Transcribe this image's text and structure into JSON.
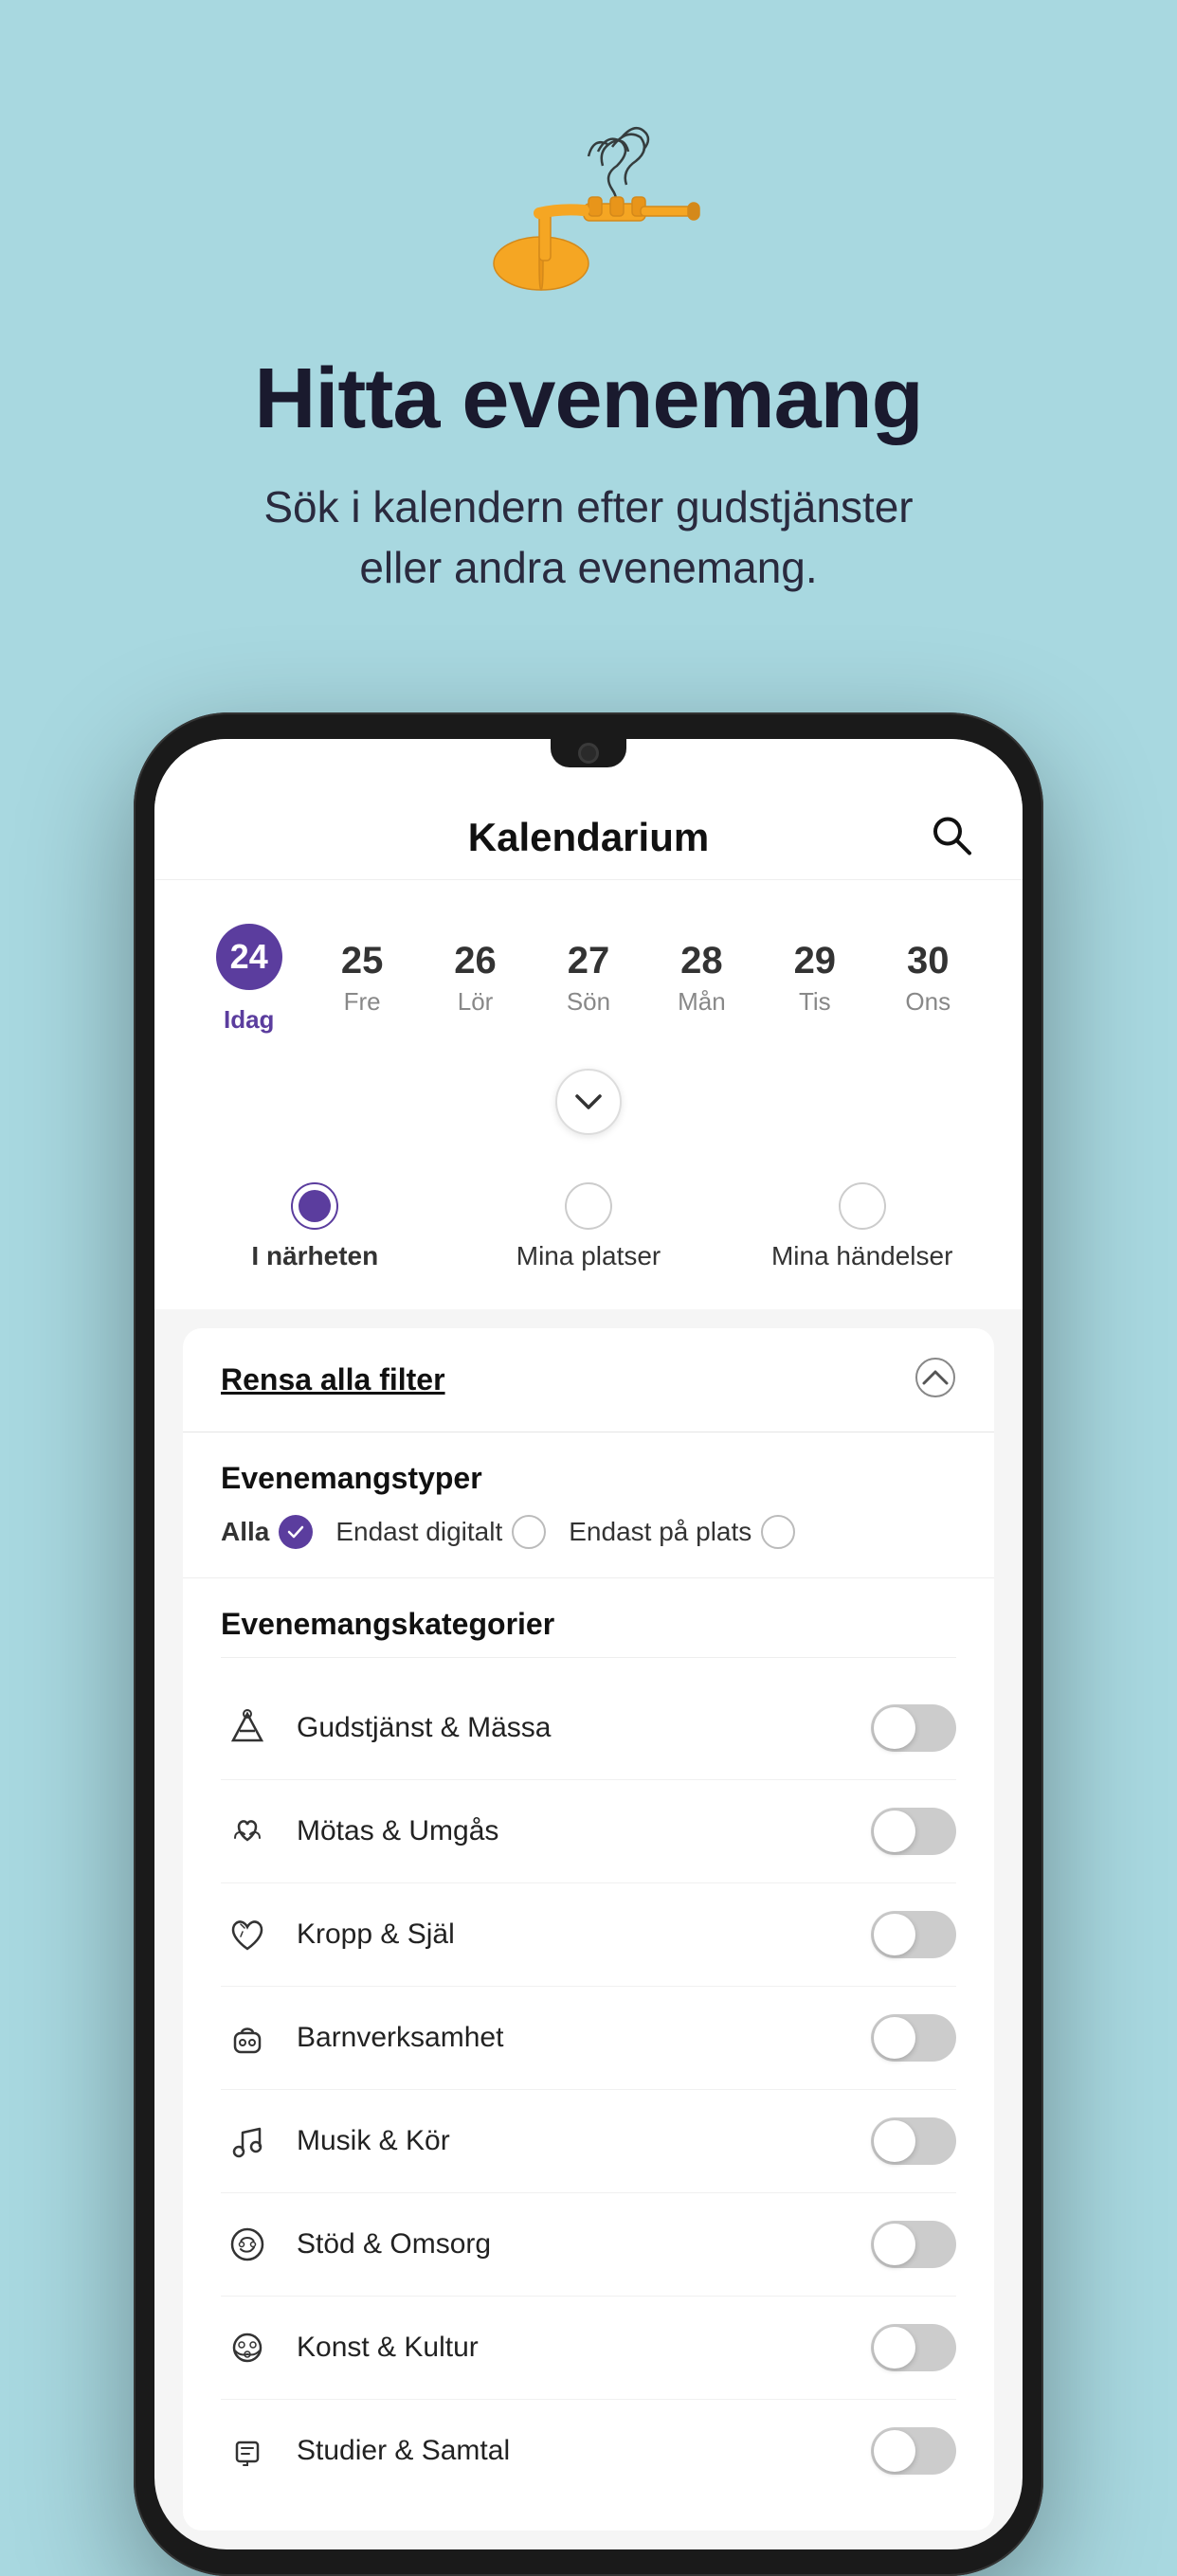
{
  "background_color": "#a8d8e0",
  "hero": {
    "title": "Hitta evenemang",
    "subtitle": "Sök i kalendern efter gudstjänster eller andra evenemang."
  },
  "app": {
    "header_title": "Kalendarium",
    "search_icon_label": "sök"
  },
  "calendar": {
    "days": [
      {
        "number": "24",
        "label": "Idag",
        "active": true
      },
      {
        "number": "25",
        "label": "Fre",
        "active": false
      },
      {
        "number": "26",
        "label": "Lör",
        "active": false
      },
      {
        "number": "27",
        "label": "Sön",
        "active": false
      },
      {
        "number": "28",
        "label": "Mån",
        "active": false
      },
      {
        "number": "29",
        "label": "Tis",
        "active": false
      },
      {
        "number": "30",
        "label": "Ons",
        "active": false
      }
    ]
  },
  "filter_tabs": [
    {
      "id": "nearby",
      "label": "I närheten",
      "active": true
    },
    {
      "id": "places",
      "label": "Mina platser",
      "active": false
    },
    {
      "id": "events",
      "label": "Mina händelser",
      "active": false
    }
  ],
  "filter_panel": {
    "clear_label": "Rensa alla filter",
    "event_types_title": "Evenemangstyper",
    "event_types": [
      {
        "label": "Alla",
        "checked": true
      },
      {
        "label": "Endast digitalt",
        "checked": false
      },
      {
        "label": "Endast på plats",
        "checked": false
      }
    ],
    "categories_title": "Evenemangskategorier",
    "categories": [
      {
        "label": "Gudstjänst & Mässa",
        "icon": "🏆",
        "enabled": false
      },
      {
        "label": "Mötas & Umgås",
        "icon": "🤝",
        "enabled": false
      },
      {
        "label": "Kropp & Själ",
        "icon": "🕊️",
        "enabled": false
      },
      {
        "label": "Barnverksamhet",
        "icon": "🧸",
        "enabled": false
      },
      {
        "label": "Musik & Kör",
        "icon": "🎵",
        "enabled": false
      },
      {
        "label": "Stöd & Omsorg",
        "icon": "🎭",
        "enabled": false
      },
      {
        "label": "Konst & Kultur",
        "icon": "🎨",
        "enabled": false
      },
      {
        "label": "Studier & Samtal",
        "icon": "📚",
        "enabled": false
      }
    ]
  }
}
